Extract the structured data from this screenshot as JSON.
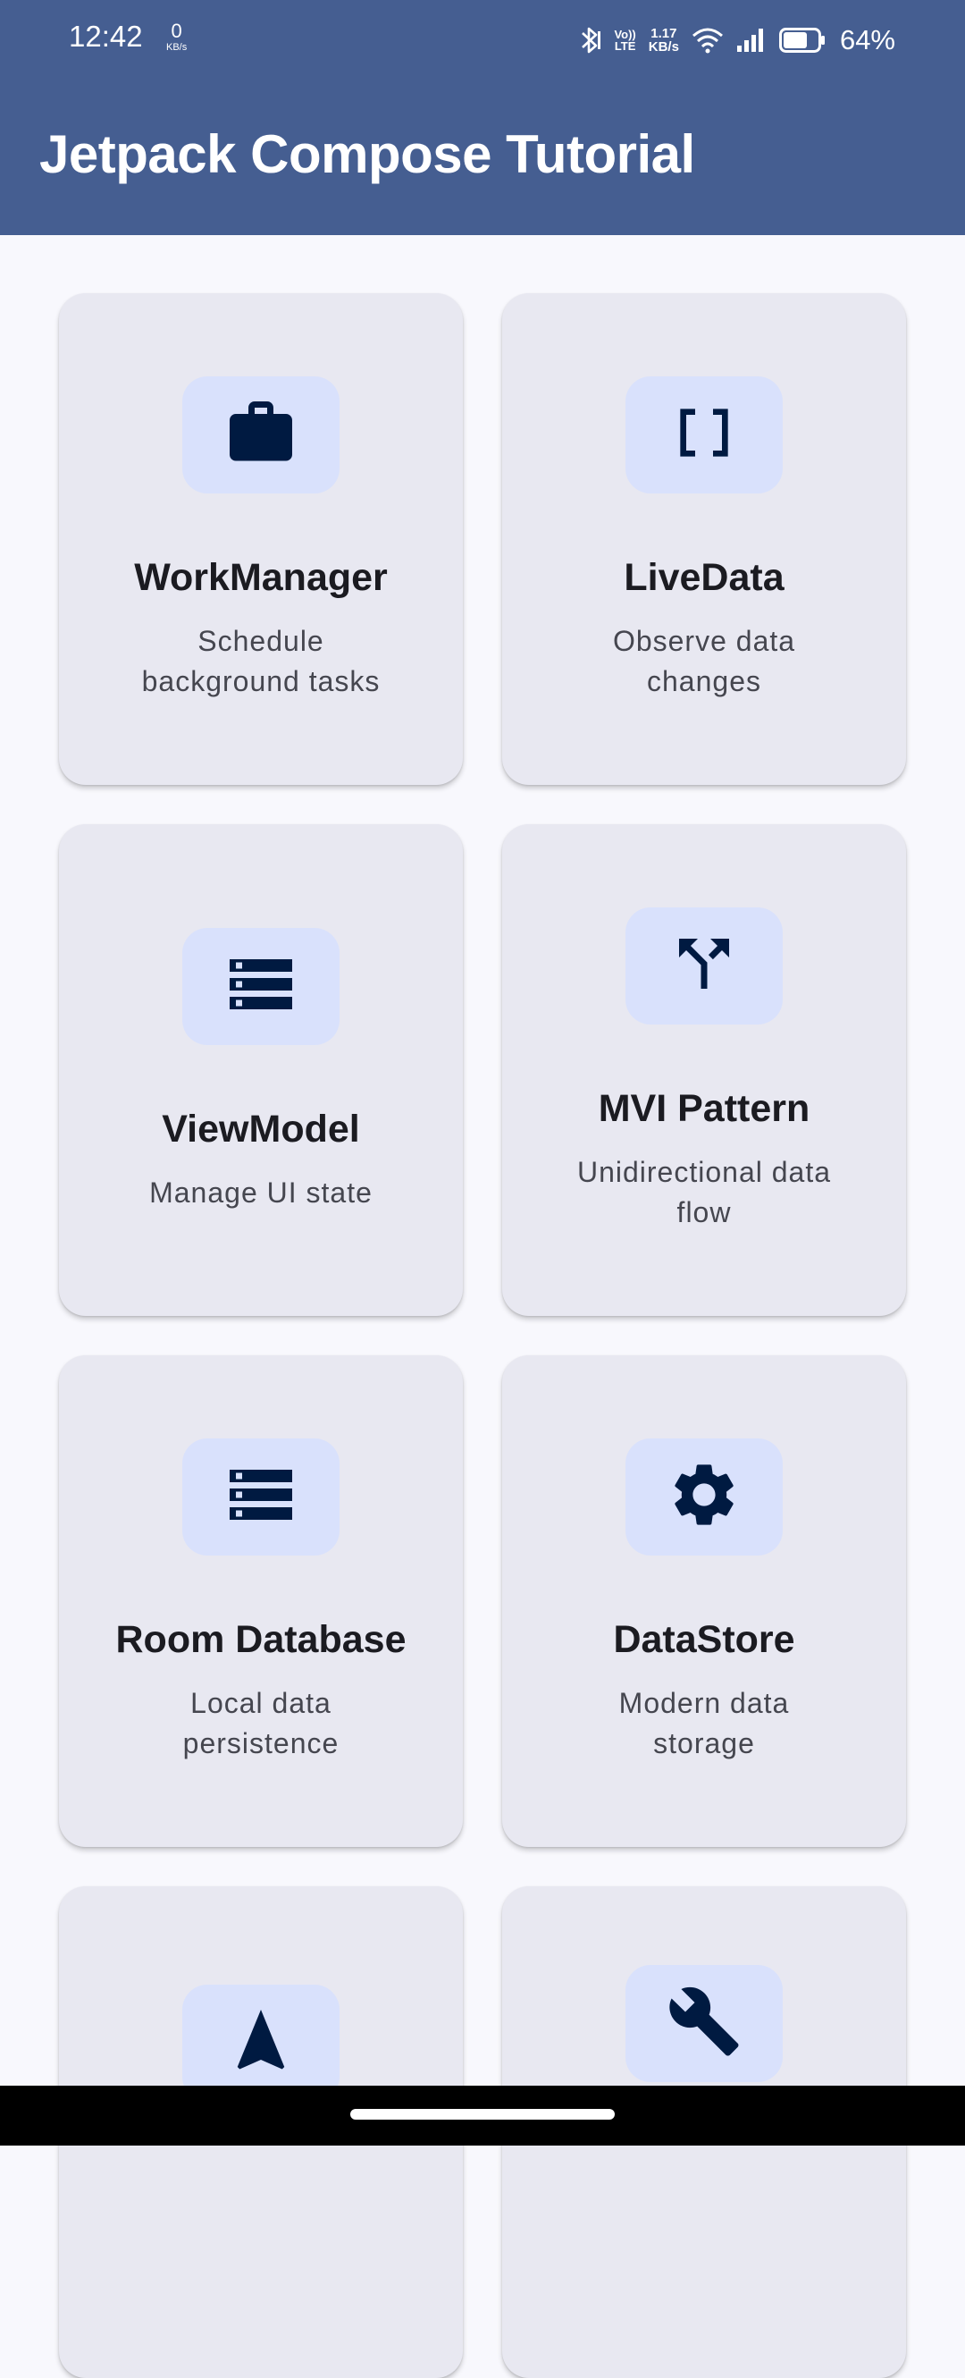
{
  "status_bar": {
    "time": "12:42",
    "speed_value": "0",
    "speed_unit": "KB/s",
    "volte_top": "Vo))",
    "volte_bottom": "LTE",
    "net_speed_value": "1.17",
    "net_speed_unit": "KB/s",
    "battery_percent": "64%",
    "icons": [
      "bluetooth-icon",
      "volte-icon",
      "wifi-icon",
      "signal-icon",
      "battery-icon"
    ]
  },
  "app_bar": {
    "title": "Jetpack Compose Tutorial",
    "color": "#455e91"
  },
  "cards": [
    {
      "title": "WorkManager",
      "description": "Schedule background tasks",
      "icon": "briefcase-icon"
    },
    {
      "title": "LiveData",
      "description": "Observe data changes",
      "icon": "data-array-icon"
    },
    {
      "title": "ViewModel",
      "description": "Manage UI state",
      "icon": "list-storage-icon"
    },
    {
      "title": "MVI Pattern",
      "description": "Unidirectional data flow",
      "icon": "fork-arrow-icon"
    },
    {
      "title": "Room Database",
      "description": "Local data persistence",
      "icon": "list-storage-icon"
    },
    {
      "title": "DataStore",
      "description": "Modern data storage",
      "icon": "gear-icon"
    },
    {
      "title": "",
      "description": "",
      "icon": "navigation-arrow-icon"
    },
    {
      "title": "",
      "description": "",
      "icon": "wrench-icon"
    }
  ],
  "colors": {
    "card_bg": "#e8e8f1",
    "icon_bg": "#d9e1fc",
    "icon_fg": "#001a41",
    "title_text": "#1b1b21",
    "desc_text": "#45464f"
  }
}
